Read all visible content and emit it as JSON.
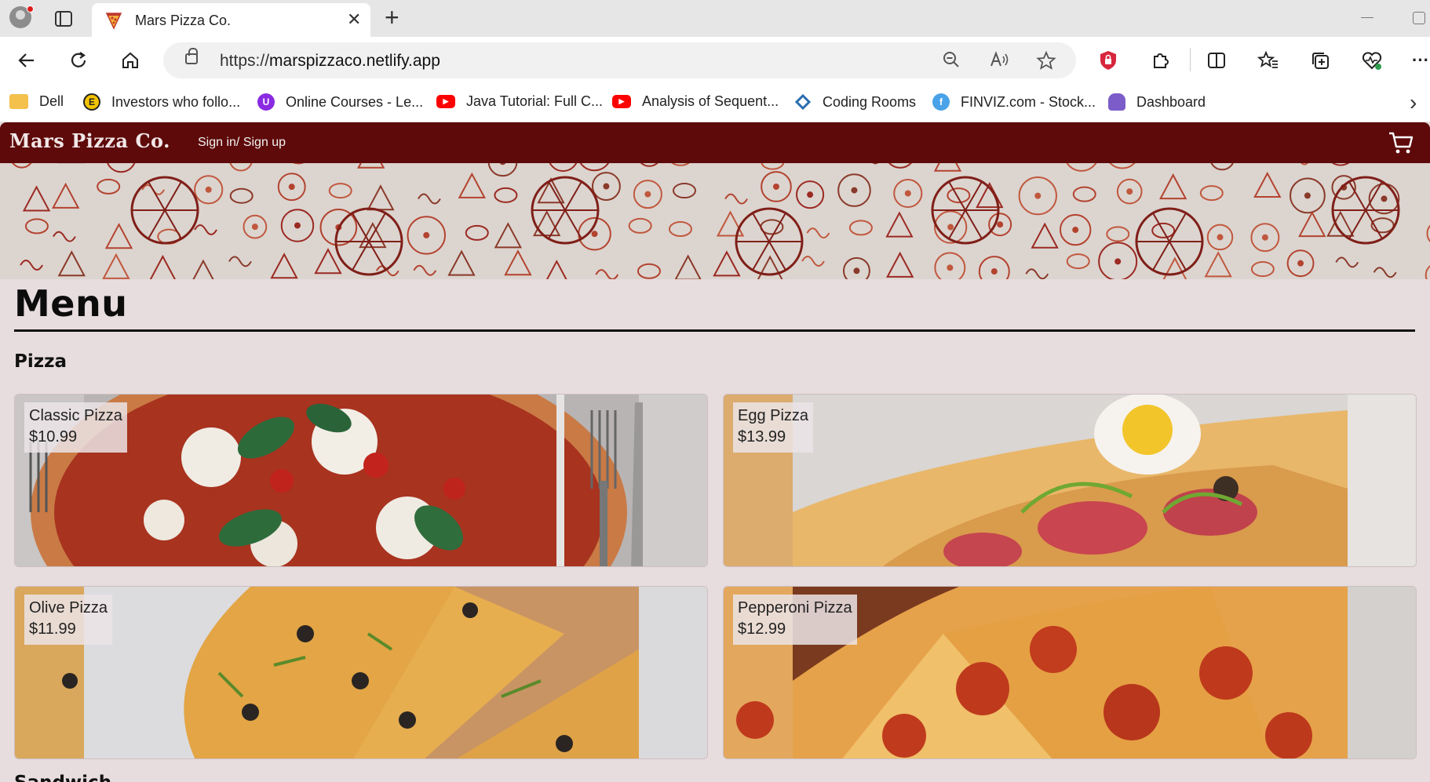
{
  "browser": {
    "tab_title": "Mars Pizza Co.",
    "url_scheme": "https://",
    "url_host": "marspizzaco.netlify.app",
    "bookmarks": [
      {
        "label": "Dell",
        "icon": "folder-icon",
        "color": "#e8b53b"
      },
      {
        "label": "Investors who follo...",
        "icon": "e-logo-icon",
        "color": "#f2c300"
      },
      {
        "label": "Online Courses - Le...",
        "icon": "udemy-icon",
        "color": "#8a2be2"
      },
      {
        "label": "Java Tutorial: Full C...",
        "icon": "youtube-icon",
        "color": "#ff0000"
      },
      {
        "label": "Analysis of Sequent...",
        "icon": "youtube-icon",
        "color": "#ff0000"
      },
      {
        "label": "Coding Rooms",
        "icon": "coding-rooms-icon",
        "color": "#2a6db0"
      },
      {
        "label": "FINVIZ.com - Stock...",
        "icon": "finviz-icon",
        "color": "#4aa3e8"
      },
      {
        "label": "Dashboard",
        "icon": "dashboard-icon",
        "color": "#7b5cc9"
      }
    ]
  },
  "site": {
    "brand": "Mars Pizza Co.",
    "signin": "Sign in/ Sign up",
    "header_color": "#5e0a0a",
    "menu_title": "Menu",
    "sections": [
      {
        "title": "Pizza",
        "items": [
          {
            "name": "Classic Pizza",
            "price": "$10.99"
          },
          {
            "name": "Egg Pizza",
            "price": "$13.99"
          },
          {
            "name": "Olive Pizza",
            "price": "$11.99"
          },
          {
            "name": "Pepperoni Pizza",
            "price": "$12.99"
          }
        ]
      },
      {
        "title": "Sandwich"
      }
    ]
  }
}
